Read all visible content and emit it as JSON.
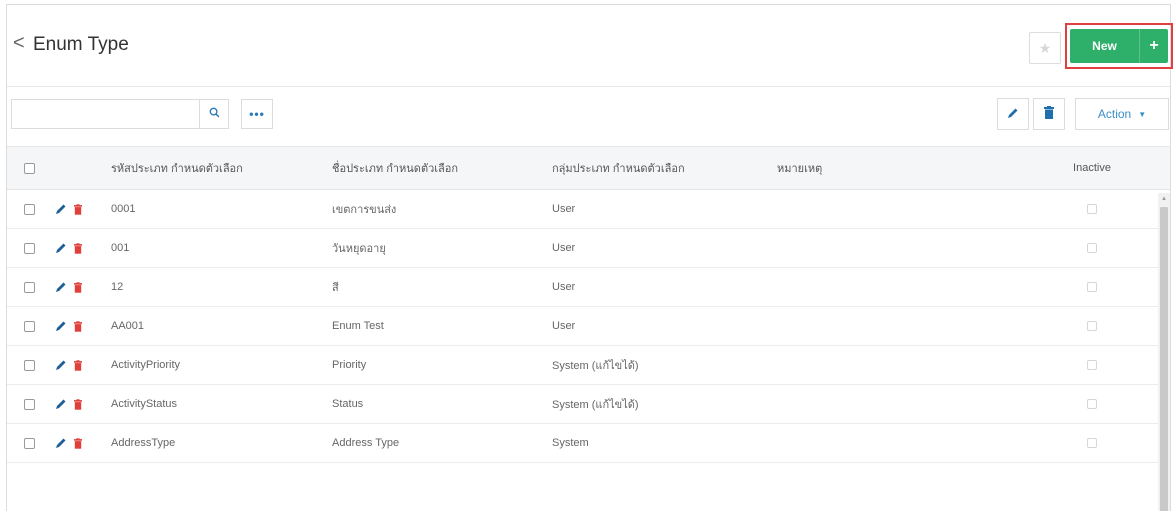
{
  "header": {
    "back_glyph": "<",
    "title": "Enum Type",
    "star_glyph": "★",
    "new_label": "New",
    "new_plus_glyph": "+"
  },
  "toolbar": {
    "search_placeholder": "",
    "search_icon": "search-icon",
    "more_label": "•••",
    "edit_icon": "pencil-icon",
    "delete_icon": "trash-icon",
    "action_label": "Action",
    "action_caret": "▼"
  },
  "colors": {
    "accent_blue": "#2a7ab8",
    "new_green": "#2eb06a",
    "delete_red": "#e0403a",
    "highlight_border": "#e04040"
  },
  "table": {
    "columns": [
      "รหัสประเภท กำหนดตัวเลือก",
      "ชื่อประเภท กำหนดตัวเลือก",
      "กลุ่มประเภท กำหนดตัวเลือก",
      "หมายเหตุ",
      "Inactive"
    ],
    "rows": [
      {
        "code": "0001",
        "name": "เขตการขนส่ง",
        "group": "User",
        "note": ""
      },
      {
        "code": "001",
        "name": "วันหยุดอายุ",
        "group": "User",
        "note": ""
      },
      {
        "code": "12",
        "name": "สี",
        "group": "User",
        "note": ""
      },
      {
        "code": "AA001",
        "name": "Enum Test",
        "group": "User",
        "note": ""
      },
      {
        "code": "ActivityPriority",
        "name": "Priority",
        "group": "System (แก้ไขได้)",
        "note": ""
      },
      {
        "code": "ActivityStatus",
        "name": "Status",
        "group": "System (แก้ไขได้)",
        "note": ""
      },
      {
        "code": "AddressType",
        "name": "Address Type",
        "group": "System",
        "note": ""
      }
    ]
  }
}
